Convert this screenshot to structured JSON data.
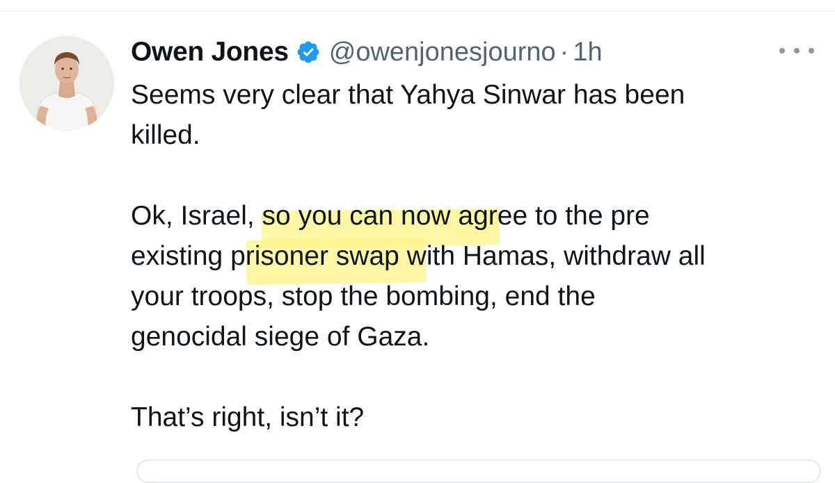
{
  "tweet": {
    "display_name": "Owen Jones",
    "handle": "@owenjonesjourno",
    "separator": "·",
    "time": "1h",
    "verified_icon": "verified-badge-icon",
    "more_icon": "more-horizontal-icon",
    "avatar_icon": "avatar-photo",
    "paragraphs": [
      {
        "lines": [
          "Seems very clear that Yahya Sinwar has been",
          "killed."
        ]
      },
      {
        "lines": [
          "Ok, Israel, so you can now agree to the pre",
          "existing prisoner swap with Hamas, withdraw all",
          "your troops, stop the bombing, end the",
          "genocidal siege of Gaza."
        ]
      },
      {
        "lines": [
          "That’s right, isn’t it?"
        ]
      }
    ]
  },
  "colors": {
    "text": "#0f1419",
    "secondary": "#536471",
    "verified": "#1d9bf0",
    "highlight": "#fbf58a",
    "divider": "#eff3f4"
  }
}
